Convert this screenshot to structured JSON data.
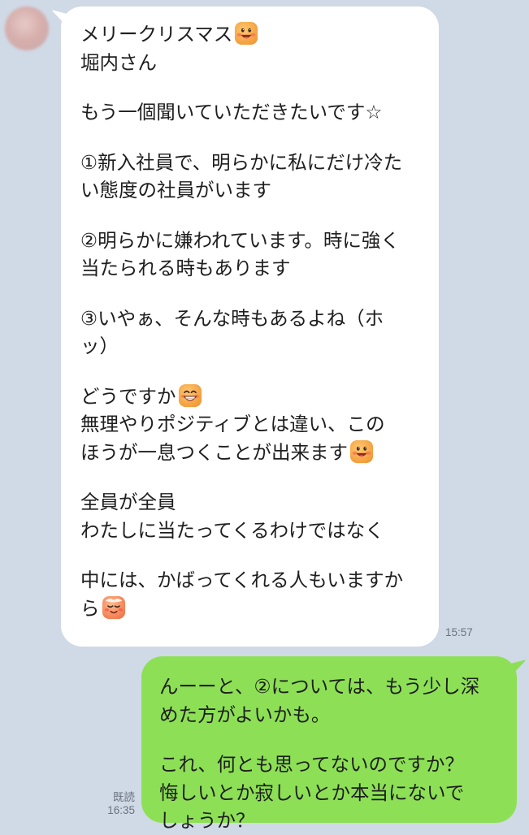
{
  "chat": {
    "incoming": {
      "time": "15:57",
      "lines": [
        {
          "text": "メリークリスマス",
          "emoji": "grinning-face-emoji"
        },
        {
          "text": "堀内さん"
        },
        {
          "text": "もう一個聞いていただきたいです☆"
        },
        {
          "text": "①新入社員で、明らかに私にだけ冷た"
        },
        {
          "text": "い態度の社員がいます"
        },
        {
          "text": "②明らかに嫌われています。時に強く"
        },
        {
          "text": "当たられる時もあります"
        },
        {
          "text": "③いやぁ、そんな時もあるよね（ホ"
        },
        {
          "text": "ッ）"
        },
        {
          "text": "どうですか",
          "emoji": "grin-face-emoji"
        },
        {
          "text": "無理やりポジティブとは違い、この"
        },
        {
          "text": "ほうが一息つくことが出来ます",
          "emoji": "grinning-face-emoji"
        },
        {
          "text": "全員が全員"
        },
        {
          "text": "わたしに当たってくるわけではなく"
        },
        {
          "text": "中には、かばってくれる人もいますか"
        },
        {
          "text": "ら",
          "emoji": "relieved-face-emoji"
        }
      ]
    },
    "outgoing": {
      "read_label": "既読",
      "time": "16:35",
      "lines": [
        {
          "text": "んーーと、②については、もう少し深"
        },
        {
          "text": "めた方がよいかも。"
        },
        {
          "text": "これ、何とも思ってないのですか？"
        },
        {
          "text": "悔しいとか寂しいとか本当にないで"
        },
        {
          "text": "しょうか？"
        }
      ]
    }
  },
  "colors": {
    "background": "#d0d9e6",
    "incoming_bubble": "#ffffff",
    "outgoing_bubble": "#8de055",
    "meta_text": "#6a7280"
  }
}
